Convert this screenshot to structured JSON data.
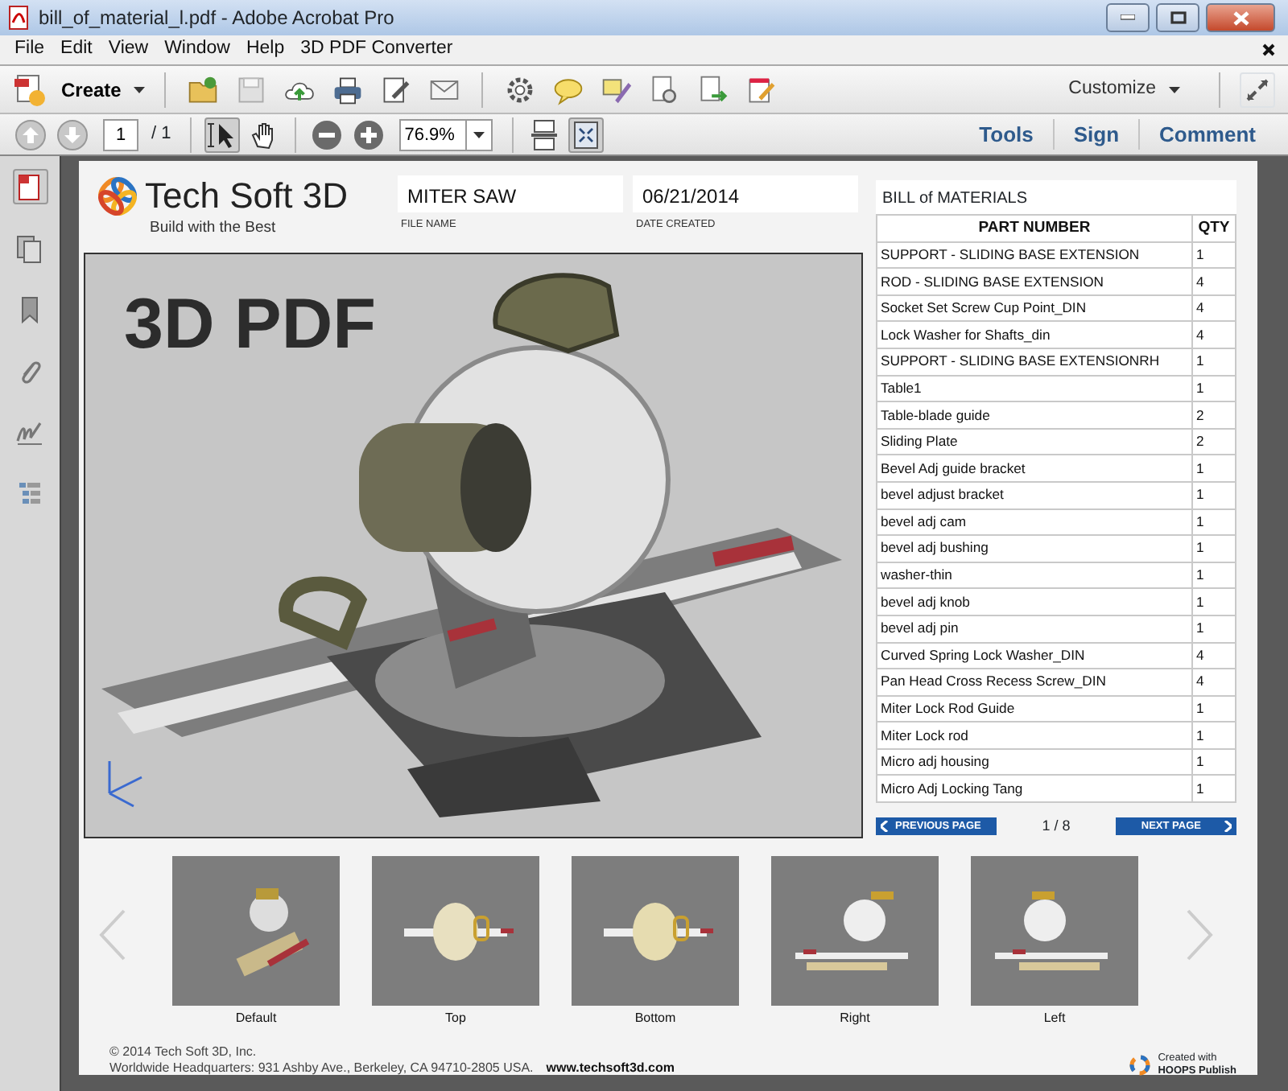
{
  "window": {
    "title": "bill_of_material_l.pdf - Adobe Acrobat Pro"
  },
  "menu": [
    "File",
    "Edit",
    "View",
    "Window",
    "Help",
    "3D PDF Converter"
  ],
  "toolbar": {
    "create_label": "Create",
    "customize_label": "Customize"
  },
  "nav_toolbar": {
    "nav_buttons": [
      {
        "kind": "previous",
        "disabled": true
      },
      {
        "kind": "next",
        "disabled": true
      }
    ],
    "page_number": "1",
    "page_count": "/ 1",
    "tools": [
      {
        "kind": "select",
        "selected": true
      },
      {
        "kind": "hand",
        "selected": false
      }
    ],
    "zoom": "76.9%",
    "panes": [
      "Tools",
      "Sign",
      "Comment"
    ]
  },
  "document": {
    "logo": {
      "name": "Tech Soft 3D",
      "tagline": "Build with the Best"
    },
    "fields": [
      {
        "value": "MITER SAW",
        "label": "FILE NAME"
      },
      {
        "value": "06/21/2014",
        "label": "DATE CREATED"
      }
    ],
    "viewer": {
      "overlay_title": "3D PDF"
    },
    "bom": {
      "title": "BILL of MATERIALS",
      "columns": [
        "PART NUMBER",
        "QTY"
      ],
      "rows": [
        [
          "SUPPORT - SLIDING BASE EXTENSION",
          "1"
        ],
        [
          "ROD - SLIDING BASE EXTENSION",
          "4"
        ],
        [
          "Socket Set Screw Cup Point_DIN",
          "4"
        ],
        [
          "Lock Washer for Shafts_din",
          "4"
        ],
        [
          "SUPPORT - SLIDING BASE EXTENSIONRH",
          "1"
        ],
        [
          "Table1",
          "1"
        ],
        [
          "Table-blade guide",
          "2"
        ],
        [
          "Sliding Plate",
          "2"
        ],
        [
          "Bevel Adj guide bracket",
          "1"
        ],
        [
          "bevel adjust bracket",
          "1"
        ],
        [
          "bevel adj cam",
          "1"
        ],
        [
          "bevel adj bushing",
          "1"
        ],
        [
          "washer-thin",
          "1"
        ],
        [
          "bevel adj knob",
          "1"
        ],
        [
          "bevel adj pin",
          "1"
        ],
        [
          "Curved Spring Lock Washer_DIN",
          "4"
        ],
        [
          "Pan Head Cross Recess Screw_DIN",
          "4"
        ],
        [
          "Miter Lock Rod Guide",
          "1"
        ],
        [
          "Miter Lock rod",
          "1"
        ],
        [
          "Micro adj housing",
          "1"
        ],
        [
          "Micro Adj Locking Tang",
          "1"
        ]
      ]
    },
    "pager": {
      "previous": "PREVIOUS PAGE",
      "position": "1 / 8",
      "next": "NEXT PAGE"
    },
    "views": [
      {
        "label": "Default"
      },
      {
        "label": "Top"
      },
      {
        "label": "Bottom"
      },
      {
        "label": "Right"
      },
      {
        "label": "Left"
      }
    ],
    "footer": {
      "copyright": "© 2014 Tech Soft 3D, Inc.",
      "address": "Worldwide Headquarters: 931 Ashby Ave., Berkeley, CA 94710-2805 USA.",
      "website": "www.techsoft3d.com",
      "badge_line1": "Created with",
      "badge_line2": "HOOPS Publish"
    }
  }
}
